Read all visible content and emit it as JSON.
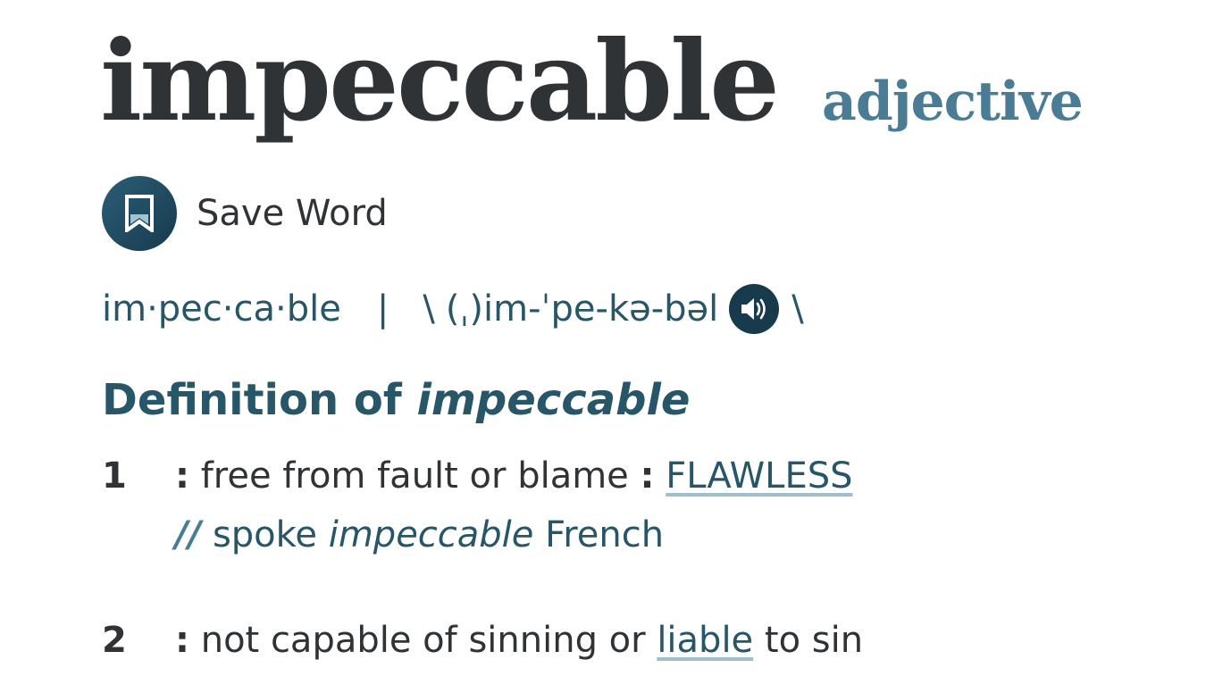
{
  "entry": {
    "headword": "impeccable",
    "part_of_speech": "adjective"
  },
  "save": {
    "icon": "bookmark-icon",
    "label": "Save Word"
  },
  "pronunciation": {
    "syllables": "im·pec·ca·ble",
    "separator": "|",
    "open_slash": "\\",
    "ipa": "(ˌ)im-ˈpe-kə-bəl",
    "audio_icon": "speaker-icon",
    "close_slash": "\\"
  },
  "definition": {
    "heading_prefix": "Definition of",
    "heading_word": "impeccable",
    "senses": [
      {
        "number": "1",
        "colon": ":",
        "text": "free from fault or blame",
        "colon2": ":",
        "xref": "FLAWLESS",
        "example": {
          "marker": "//",
          "before": "spoke",
          "italic": "impeccable",
          "after": "French"
        }
      },
      {
        "number": "2",
        "colon": ":",
        "text_before": "not capable of sinning or",
        "xref": "liable",
        "text_after": "to sin"
      }
    ]
  },
  "colors": {
    "headword": "#303336",
    "part_of_speech": "#4a7d95",
    "accent": "#265667",
    "button": "#183a4d"
  }
}
